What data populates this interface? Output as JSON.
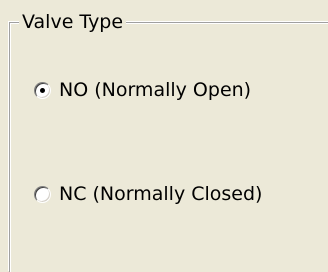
{
  "valve_type_group": {
    "title": "Valve Type",
    "options": [
      {
        "label": "NO (Normally Open)",
        "checked": true
      },
      {
        "label": "NC (Normally Closed)",
        "checked": false
      }
    ]
  }
}
